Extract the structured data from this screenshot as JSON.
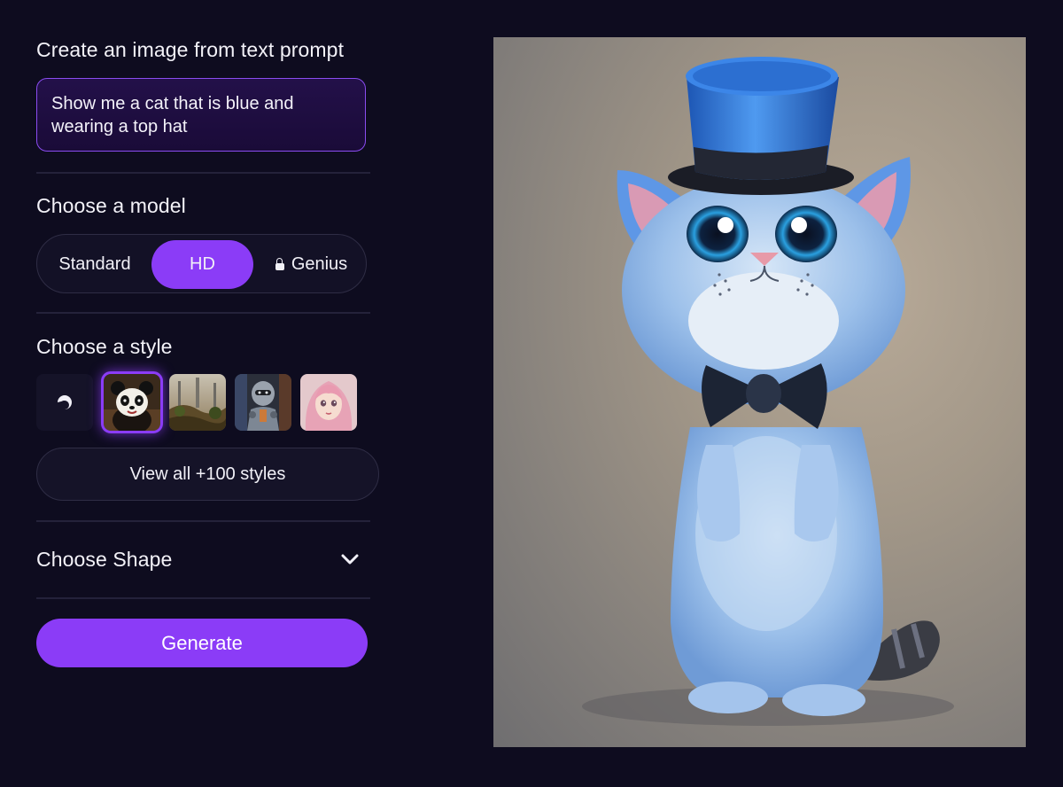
{
  "prompt": {
    "title": "Create an image from text prompt",
    "value": "Show me a cat that is blue and\nwearing a top hat"
  },
  "model": {
    "title": "Choose a model",
    "options": [
      "Standard",
      "HD",
      "Genius"
    ],
    "selected": "HD",
    "locked": [
      "Genius"
    ]
  },
  "style": {
    "title": "Choose a style",
    "thumbnails": [
      "no-style-icon",
      "panda-style",
      "landscape-style",
      "robot-style",
      "anime-girl-style"
    ],
    "selected_index": 1,
    "view_all_label": "View all +100 styles"
  },
  "shape": {
    "title": "Choose Shape",
    "icon": "chevron-down-icon"
  },
  "generate_label": "Generate",
  "colors": {
    "background": "#0e0c1f",
    "accent": "#8b3cf7",
    "prompt_border": "#8a4cf0"
  },
  "preview": {
    "subject": "blue-cat-top-hat-image"
  }
}
